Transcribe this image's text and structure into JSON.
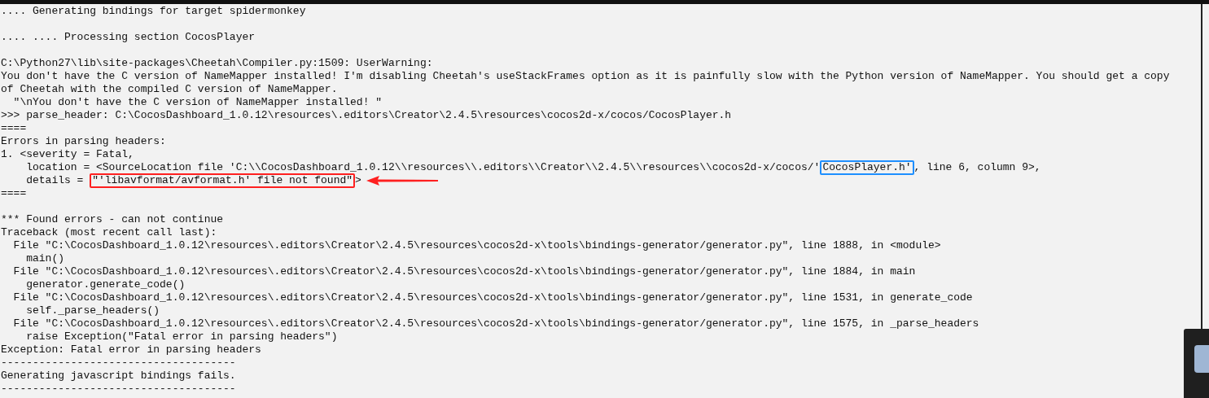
{
  "console": {
    "lines": [
      {
        "kind": "text",
        "text": ".... Generating bindings for target spidermonkey"
      },
      {
        "kind": "blank"
      },
      {
        "kind": "text",
        "text": ".... .... Processing section CocosPlayer"
      },
      {
        "kind": "blank"
      },
      {
        "kind": "text",
        "text": "C:\\Python27\\lib\\site-packages\\Cheetah\\Compiler.py:1509: UserWarning:"
      },
      {
        "kind": "text",
        "text": "You don't have the C version of NameMapper installed! I'm disabling Cheetah's useStackFrames option as it is painfully slow with the Python version of NameMapper. You should get a copy"
      },
      {
        "kind": "text",
        "text": "of Cheetah with the compiled C version of NameMapper."
      },
      {
        "kind": "text",
        "text": "  \"\\nYou don't have the C version of NameMapper installed! \""
      },
      {
        "kind": "text",
        "text": ">>> parse_header: C:\\CocosDashboard_1.0.12\\resources\\.editors\\Creator\\2.4.5\\resources\\cocos2d-x/cocos/CocosPlayer.h"
      },
      {
        "kind": "text",
        "text": "===="
      },
      {
        "kind": "text",
        "text": "Errors in parsing headers:"
      },
      {
        "kind": "text",
        "text": "1. <severity = Fatal,"
      },
      {
        "kind": "annotated",
        "parts": [
          {
            "kind": "text",
            "text": "    location = <SourceLocation file 'C:\\\\CocosDashboard_1.0.12\\\\resources\\\\.editors\\\\Creator\\\\2.4.5\\\\resources\\\\cocos2d-x/cocos/'"
          },
          {
            "kind": "boxed",
            "text": "CocosPlayer.h'",
            "color": "#1e8fff"
          },
          {
            "kind": "text",
            "text": ", line 6, column 9>,"
          }
        ]
      },
      {
        "kind": "annotated",
        "parts": [
          {
            "kind": "text",
            "text": "    details = "
          },
          {
            "kind": "boxed",
            "text": "\"'libavformat/avformat.h' file not found\"",
            "color": "#ff2020"
          },
          {
            "kind": "text",
            "text": ">"
          },
          {
            "kind": "arrow",
            "color": "#ff2020"
          }
        ]
      },
      {
        "kind": "text",
        "text": "===="
      },
      {
        "kind": "blank"
      },
      {
        "kind": "text",
        "text": "*** Found errors - can not continue"
      },
      {
        "kind": "text",
        "text": "Traceback (most recent call last):"
      },
      {
        "kind": "text",
        "text": "  File \"C:\\CocosDashboard_1.0.12\\resources\\.editors\\Creator\\2.4.5\\resources\\cocos2d-x\\tools\\bindings-generator/generator.py\", line 1888, in <module>"
      },
      {
        "kind": "text",
        "text": "    main()"
      },
      {
        "kind": "text",
        "text": "  File \"C:\\CocosDashboard_1.0.12\\resources\\.editors\\Creator\\2.4.5\\resources\\cocos2d-x\\tools\\bindings-generator/generator.py\", line 1884, in main"
      },
      {
        "kind": "text",
        "text": "    generator.generate_code()"
      },
      {
        "kind": "text",
        "text": "  File \"C:\\CocosDashboard_1.0.12\\resources\\.editors\\Creator\\2.4.5\\resources\\cocos2d-x\\tools\\bindings-generator/generator.py\", line 1531, in generate_code"
      },
      {
        "kind": "text",
        "text": "    self._parse_headers()"
      },
      {
        "kind": "text",
        "text": "  File \"C:\\CocosDashboard_1.0.12\\resources\\.editors\\Creator\\2.4.5\\resources\\cocos2d-x\\tools\\bindings-generator/generator.py\", line 1575, in _parse_headers"
      },
      {
        "kind": "text",
        "text": "    raise Exception(\"Fatal error in parsing headers\")"
      },
      {
        "kind": "text",
        "text": "Exception: Fatal error in parsing headers"
      },
      {
        "kind": "text",
        "text": "-------------------------------------"
      },
      {
        "kind": "text",
        "text": "Generating javascript bindings fails."
      },
      {
        "kind": "text",
        "text": "-------------------------------------"
      }
    ]
  }
}
